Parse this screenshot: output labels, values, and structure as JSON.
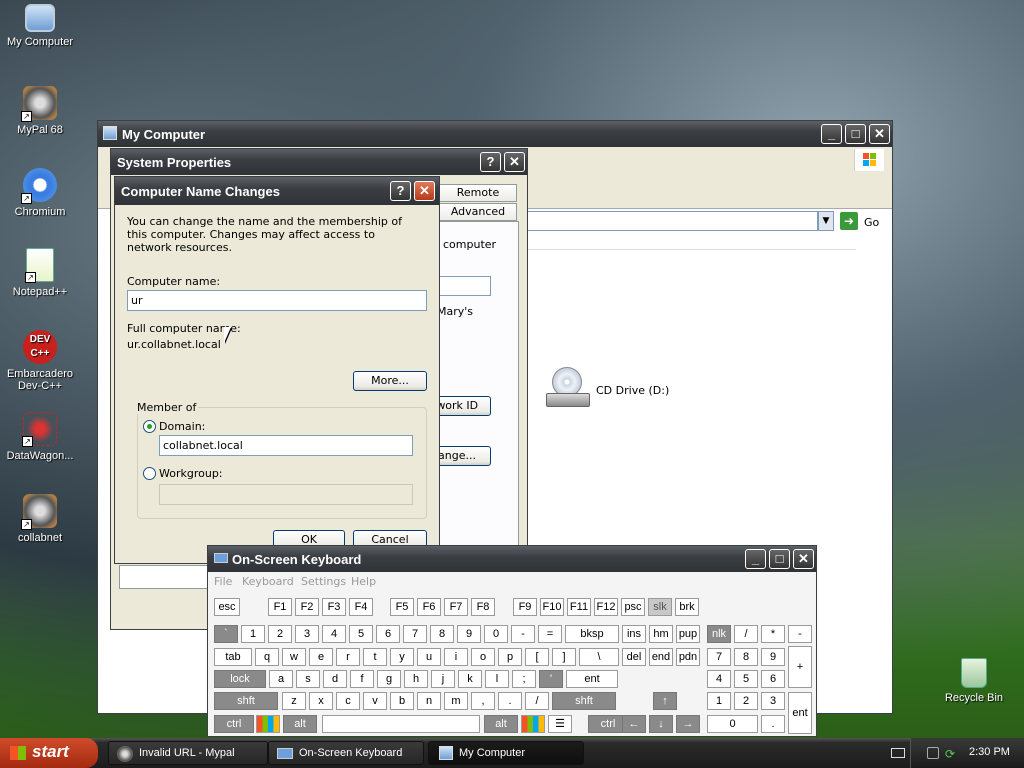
{
  "desktop": {
    "icons": [
      {
        "label": "My Computer"
      },
      {
        "label": "MyPal 68"
      },
      {
        "label": "Chromium"
      },
      {
        "label": "Notepad++"
      },
      {
        "label": "Embarcadero Dev-C++"
      },
      {
        "label": "DataWagon..."
      },
      {
        "label": "collabnet"
      },
      {
        "label": "Recycle Bin"
      }
    ]
  },
  "my_computer": {
    "title": "My Computer",
    "go_label": "Go",
    "cd_drive_label": "CD Drive (D:)"
  },
  "system_properties": {
    "title": "System Properties",
    "tabs": [
      "Remote",
      "Advanced"
    ],
    "partial_texts": [
      "computer",
      "Mary's",
      "twork ID",
      "ange..."
    ]
  },
  "name_changes": {
    "title": "Computer Name Changes",
    "description": "You can change the name and the membership of this computer. Changes may affect access to network resources.",
    "computer_name_label": "Computer name:",
    "computer_name_value": "ur",
    "full_name_label": "Full computer name:",
    "full_name_value": "ur.collabnet.local",
    "more_button": "More...",
    "member_of_label": "Member of",
    "domain_label": "Domain:",
    "domain_value": "collabnet.local",
    "workgroup_label": "Workgroup:",
    "workgroup_value": "",
    "ok_button": "OK",
    "cancel_button": "Cancel"
  },
  "osk": {
    "title": "On-Screen Keyboard",
    "menu": [
      "File",
      "Keyboard",
      "Settings",
      "Help"
    ],
    "row1": [
      "esc",
      "F1",
      "F2",
      "F3",
      "F4",
      "F5",
      "F6",
      "F7",
      "F8",
      "F9",
      "F10",
      "F11",
      "F12",
      "psc",
      "slk",
      "brk"
    ],
    "row2": [
      "`",
      "1",
      "2",
      "3",
      "4",
      "5",
      "6",
      "7",
      "8",
      "9",
      "0",
      "-",
      "=",
      "bksp",
      "ins",
      "hm",
      "pup",
      "nlk",
      "/",
      "*",
      "-"
    ],
    "row3": [
      "tab",
      "q",
      "w",
      "e",
      "r",
      "t",
      "y",
      "u",
      "i",
      "o",
      "p",
      "[",
      "]",
      "\\",
      "del",
      "end",
      "pdn",
      "7",
      "8",
      "9",
      "+"
    ],
    "row4": [
      "lock",
      "a",
      "s",
      "d",
      "f",
      "g",
      "h",
      "j",
      "k",
      "l",
      ";",
      "'",
      "ent",
      "4",
      "5",
      "6"
    ],
    "row5": [
      "shft",
      "z",
      "x",
      "c",
      "v",
      "b",
      "n",
      "m",
      ",",
      ".",
      "/",
      "shft",
      "↑",
      "1",
      "2",
      "3",
      "ent"
    ],
    "row6": [
      "ctrl",
      "alt",
      "alt",
      "ctrl",
      "←",
      "↓",
      "→",
      "0",
      "."
    ]
  },
  "taskbar": {
    "start_label": "start",
    "items": [
      "Invalid URL - Mypal",
      "On-Screen Keyboard",
      "My Computer"
    ],
    "clock": "2:30 PM"
  }
}
